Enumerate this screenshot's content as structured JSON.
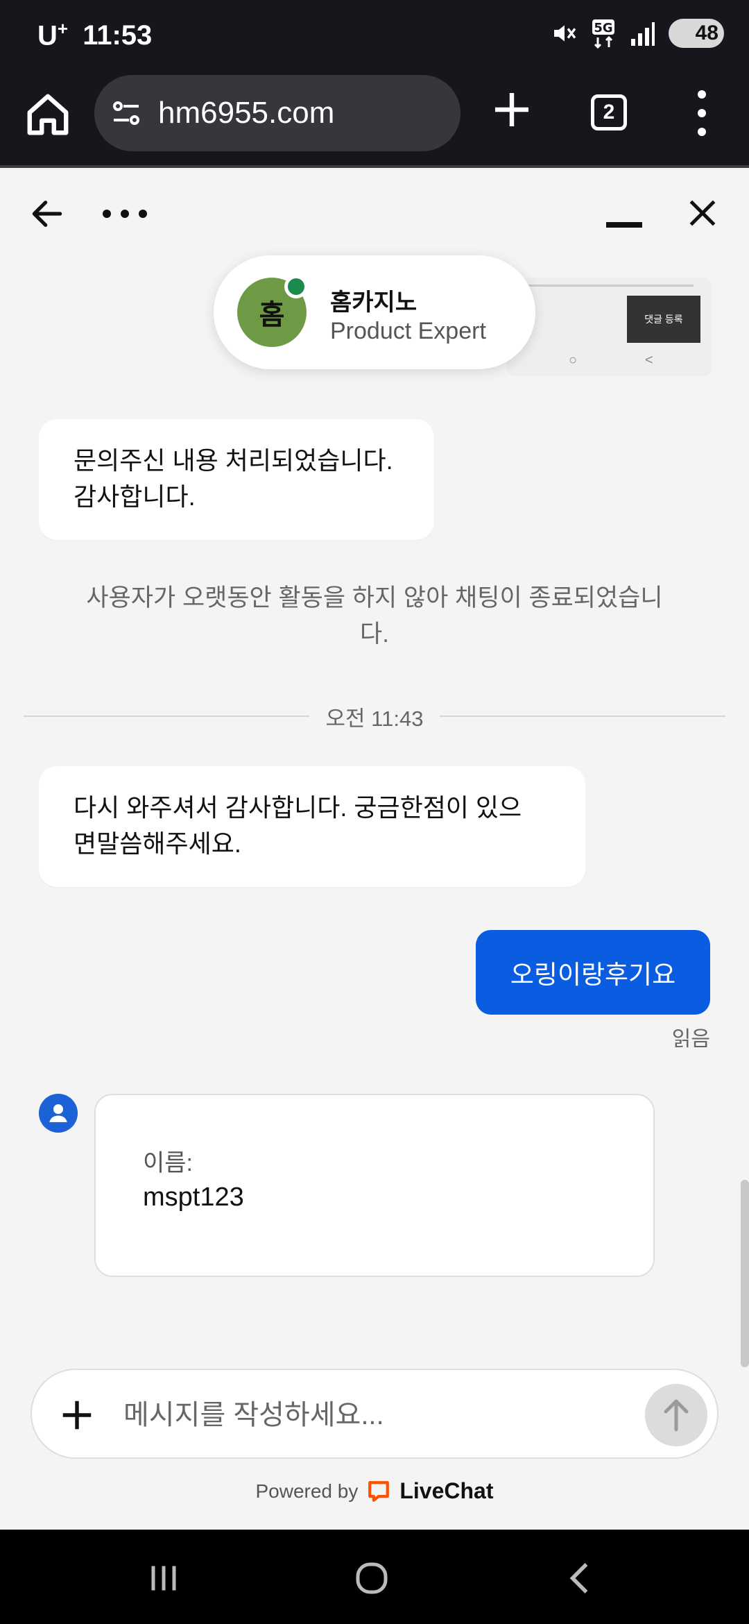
{
  "status_bar": {
    "carrier": "U",
    "carrier_sup": "+",
    "time": "11:53",
    "battery": "48",
    "network": "5G"
  },
  "browser": {
    "url": "hm6955.com",
    "tab_count": "2"
  },
  "agent": {
    "initial": "홈",
    "name": "홈카지노",
    "role": "Product Expert",
    "online_color": "#1c8a4d",
    "avatar_color": "#6e9a45"
  },
  "background_thumbnail": {
    "button_label": "댓글 등록",
    "nav_home": "○",
    "nav_back": "<"
  },
  "messages": {
    "msg1_line1": "문의주신 내용 처리되었습니다.",
    "msg1_line2": "감사합니다.",
    "system_line1": "사용자가 오랫동안 활동을 하지 않아 채팅이 종료되었습니",
    "system_line2": "다.",
    "divider_time": "오전 11:43",
    "msg2_line1": "다시 와주셔서 감사합니다. 궁금한점이 있으",
    "msg2_line2": "면말씀해주세요.",
    "outgoing": "오링이랑후기요",
    "read_receipt": "읽음"
  },
  "form": {
    "label": "이름:",
    "value": "mspt123"
  },
  "composer": {
    "placeholder": "메시지를 작성하세요..."
  },
  "footer": {
    "powered_by": "Powered by",
    "brand": "LiveChat",
    "brand_color": "#ff5100"
  },
  "colors": {
    "accent": "#0a5de0",
    "background": "#f4f4f5"
  }
}
